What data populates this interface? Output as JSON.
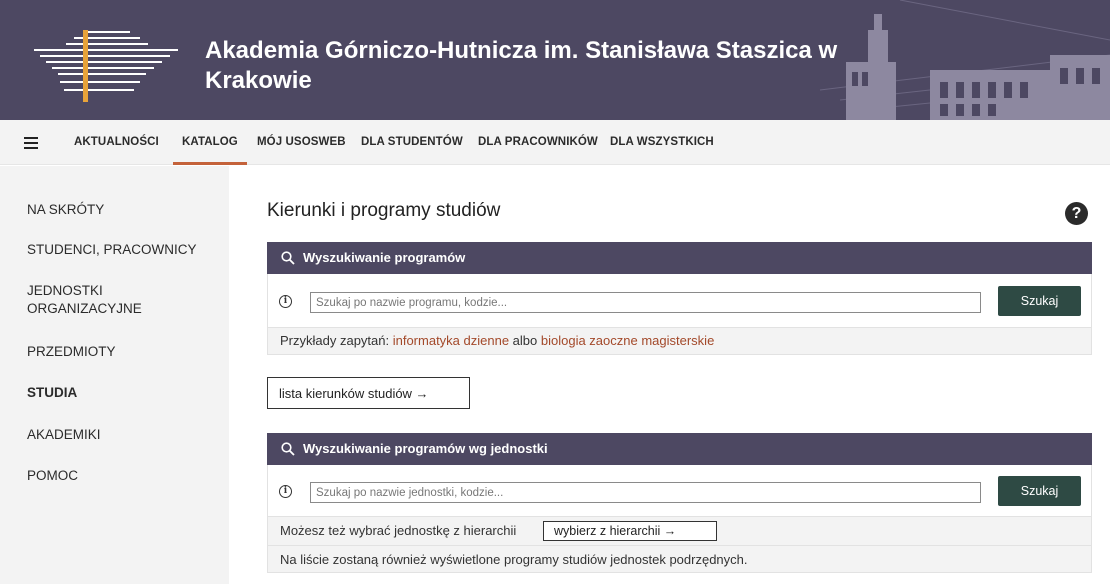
{
  "header": {
    "title_line1": "Akademia Górniczo-Hutnicza im. Stanisława Staszica w",
    "title_line2": "Krakowie",
    "bg_color": "#4d4862"
  },
  "nav": {
    "menu_icon": "hamburger-icon",
    "items": [
      {
        "label": "AKTUALNOŚCI",
        "active": false
      },
      {
        "label": "KATALOG",
        "active": true
      },
      {
        "label": "MÓJ USOSWEB",
        "active": false
      },
      {
        "label": "DLA STUDENTÓW",
        "active": false
      },
      {
        "label": "DLA PRACOWNIKÓW",
        "active": false
      },
      {
        "label": "DLA WSZYSTKICH",
        "active": false
      }
    ],
    "active_color": "#c4623a"
  },
  "sidebar": {
    "items": [
      {
        "label": "NA SKRÓTY",
        "active": false
      },
      {
        "label": "STUDENCI, PRACOWNICY",
        "active": false
      },
      {
        "label_line1": "JEDNOSTKI",
        "label_line2": "ORGANIZACYJNE",
        "active": false
      },
      {
        "label": "PRZEDMIOTY",
        "active": false
      },
      {
        "label": "STUDIA",
        "active": true
      },
      {
        "label": "AKADEMIKI",
        "active": false
      },
      {
        "label": "POMOC",
        "active": false
      }
    ]
  },
  "main": {
    "title": "Kierunki i programy studiów",
    "help_icon": "question-icon",
    "help_glyph": "?",
    "program_search": {
      "heading": "Wyszukiwanie programów",
      "info_glyph": "i",
      "placeholder": "Szukaj po nazwie programu, kodzie...",
      "button": "Szukaj",
      "examples_prefix": "Przykłady zapytań: ",
      "example1": "informatyka dzienne",
      "examples_joiner": " albo ",
      "example2": "biologia zaoczne magisterskie"
    },
    "list_button": "lista kierunków studiów →",
    "unit_search": {
      "heading": "Wyszukiwanie programów wg jednostki",
      "info_glyph": "i",
      "placeholder": "Szukaj po nazwie jednostki, kodzie...",
      "button": "Szukaj",
      "hierarchy_text": "Możesz też wybrać jednostkę z hierarchii",
      "hierarchy_button": "wybierz z hierarchii →",
      "note": "Na liście zostaną również wyświetlone programy studiów jednostek podrzędnych."
    },
    "button_color": "#2e4a44",
    "link_color": "#a3492a"
  }
}
